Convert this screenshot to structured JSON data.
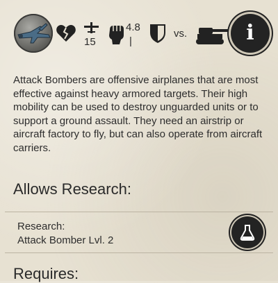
{
  "header": {
    "unit_icon": "attack-bomber-icon",
    "stat_icons": [
      "broken-heart-icon",
      "airplane-icon",
      "fist-icon",
      "shield-icon",
      "tank-icon"
    ],
    "speed_value": "15",
    "attack_value": "4.8",
    "attack_sub": "|",
    "vs_label": "vs.",
    "info_icon": "info-icon",
    "info_glyph": "i"
  },
  "description": "Attack Bombers are offensive airplanes that are most effective against heavy armored targets. Their high mobility can be used to destroy unguarded units or to support a ground assault. They need an airstrip or aircraft factory to fly, but can also operate from aircraft carriers.",
  "allows_research": {
    "title": "Allows Research:",
    "items": [
      {
        "label": "Research:",
        "value": "Attack Bomber Lvl. 2",
        "icon": "flask-icon"
      }
    ]
  },
  "requires": {
    "title": "Requires:"
  },
  "colors": {
    "background": "#e7e1d2",
    "dark_button": "#232323",
    "text": "#2d2d2d"
  }
}
